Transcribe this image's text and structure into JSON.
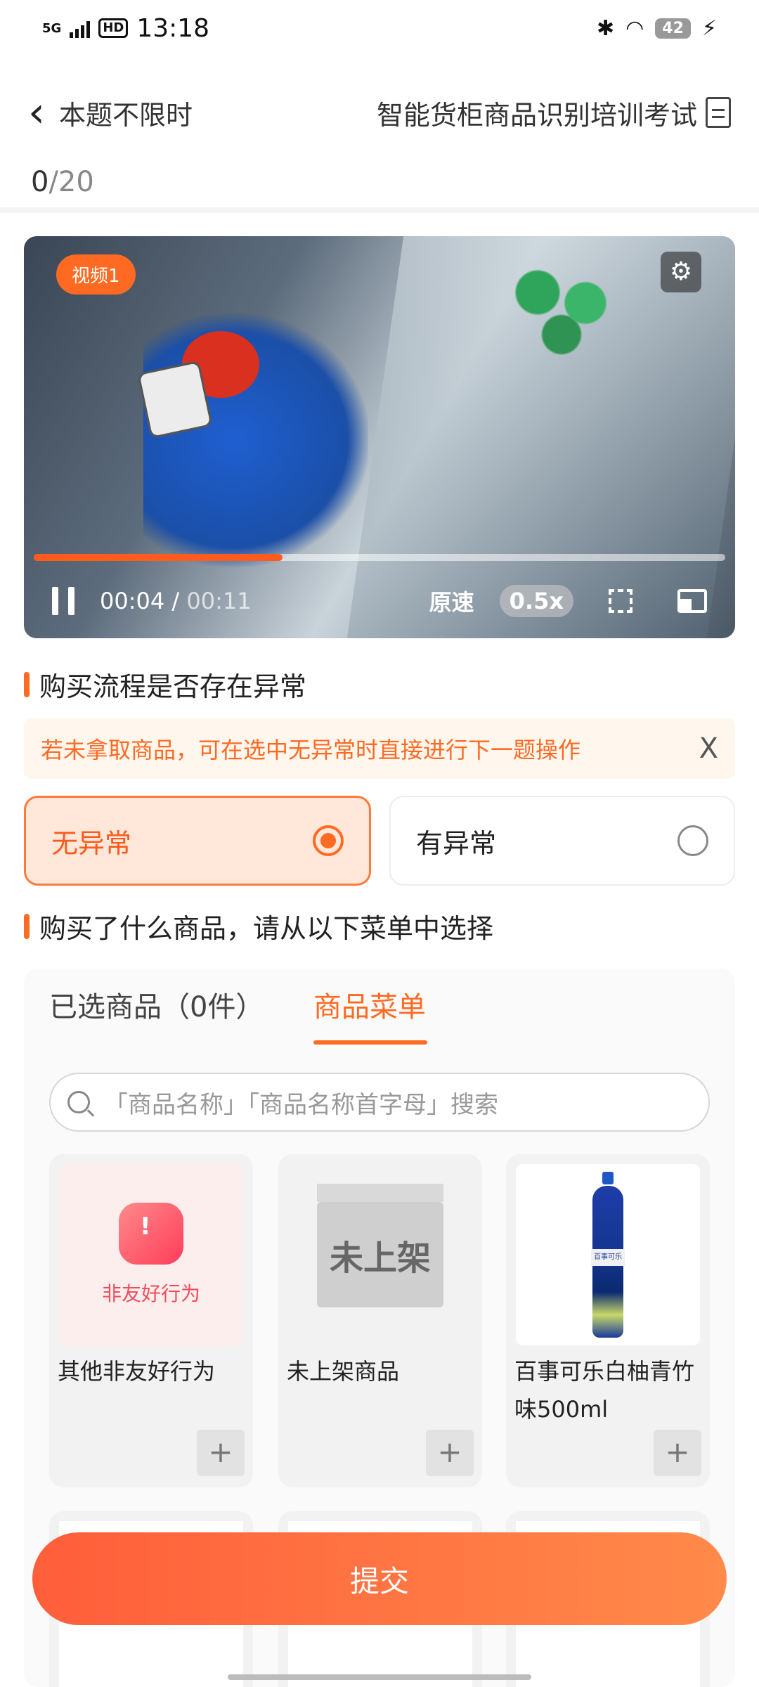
{
  "status_bar": {
    "network": "5G",
    "hd": "HD",
    "time": "13:18",
    "battery": "42"
  },
  "nav": {
    "back_label": "本题不限时",
    "title": "智能货柜商品识别培训考试"
  },
  "progress": {
    "current": "0",
    "total": "/20"
  },
  "video": {
    "badge": "视频1",
    "current_time": "00:04",
    "separator": " / ",
    "duration": "00:11",
    "progress_fraction": 0.36,
    "speed_label": "原速",
    "rate": "0.5x"
  },
  "question1": {
    "title": "购买流程是否存在异常",
    "tip": "若未拿取商品，可在选中无异常时直接进行下一题操作",
    "tip_close": "X",
    "options": [
      {
        "label": "无异常",
        "selected": true
      },
      {
        "label": "有异常",
        "selected": false
      }
    ]
  },
  "question2": {
    "title": "购买了什么商品，请从以下菜单中选择"
  },
  "tabs": {
    "selected": "已选商品（0件）",
    "menu": "商品菜单"
  },
  "search": {
    "placeholder": "「商品名称」「商品名称首字母」搜索"
  },
  "products": [
    {
      "name": "其他非友好行为",
      "image_label": "非友好行为"
    },
    {
      "name": "未上架商品",
      "image_label": "未上架"
    },
    {
      "name": "百事可乐白柚青竹味500ml",
      "image_label": "百事可乐"
    }
  ],
  "add_symbol": "+",
  "submit_label": "提交",
  "colors": {
    "accent": "#ff6a22",
    "selected_bg": "#ffe7da"
  }
}
